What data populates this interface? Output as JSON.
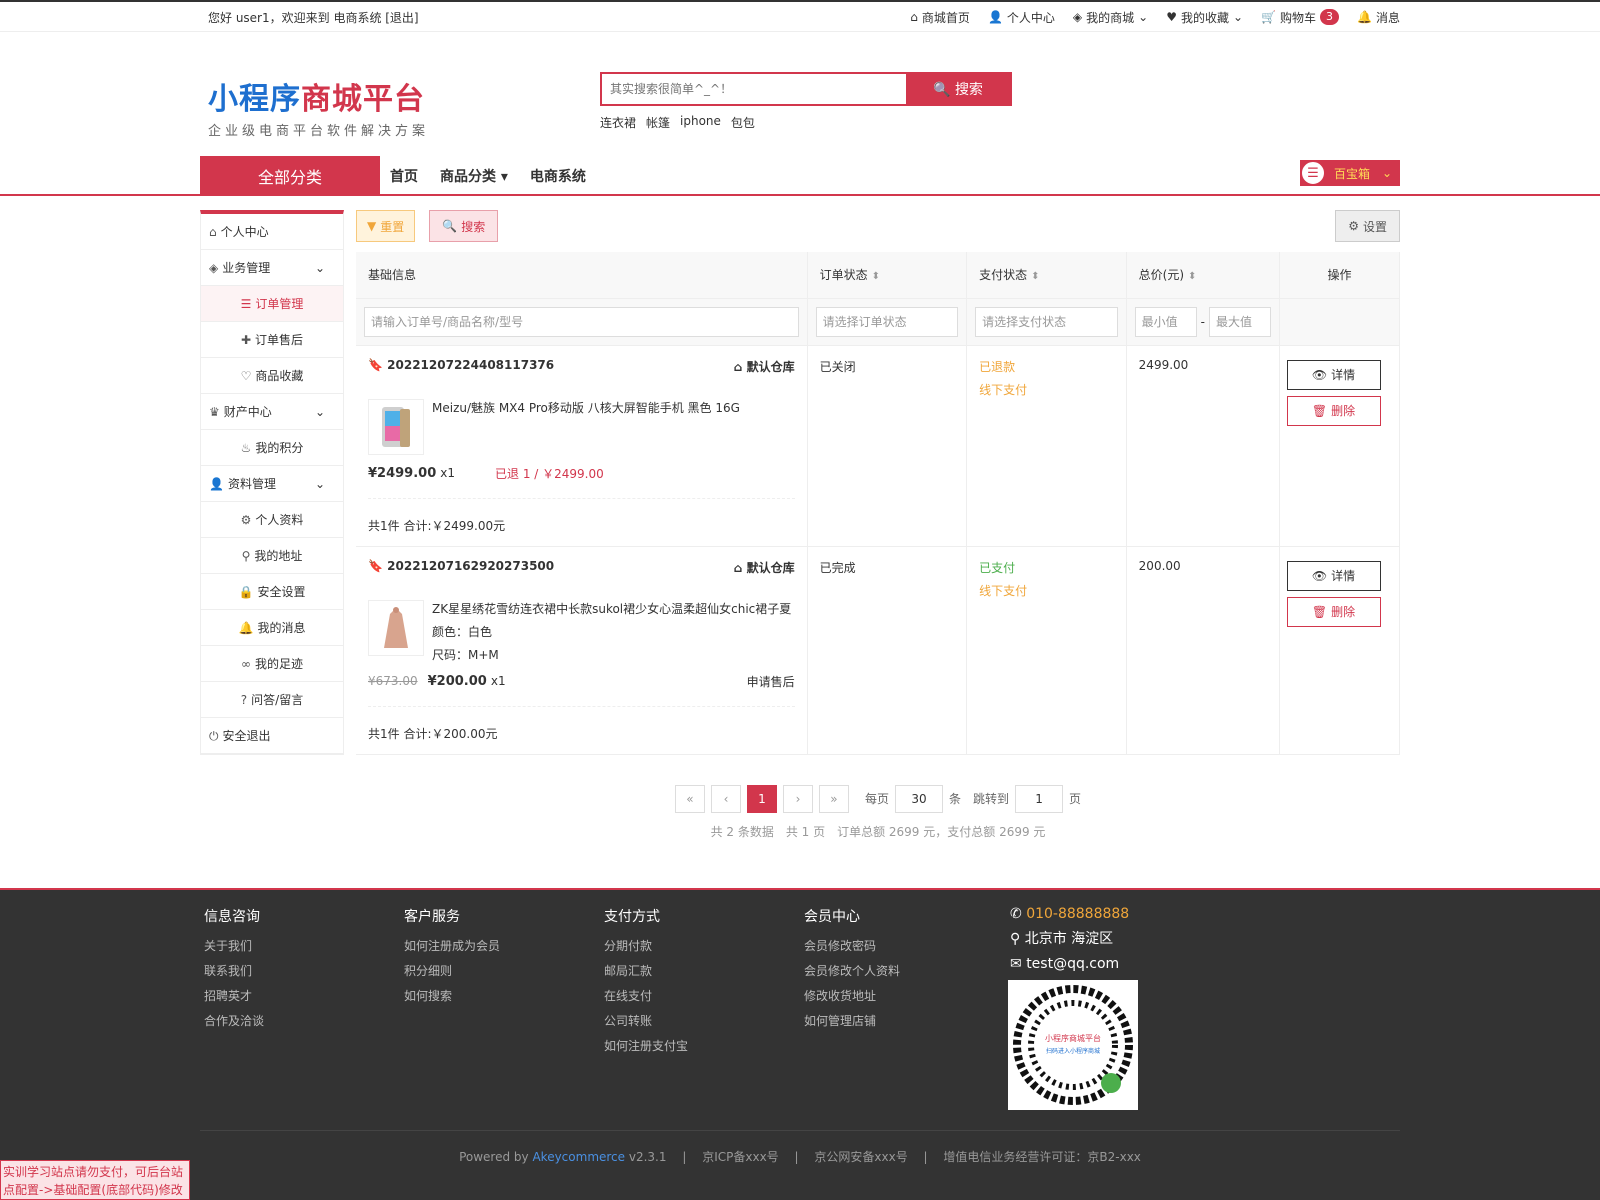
{
  "topbar": {
    "welcome": "您好 user1，欢迎来到 电商系统 [退出]",
    "links": [
      "商城首页",
      "个人中心",
      "我的商城",
      "我的收藏",
      "购物车",
      "消息"
    ],
    "cart_count": "3"
  },
  "header": {
    "logo_blue": "小程序",
    "logo_red": "商城平台",
    "logo_sub": "企业级电商平台软件解决方案",
    "search_placeholder": "其实搜索很简单^_^！",
    "search_button": "搜索",
    "hot": [
      "连衣裙",
      "帐篷",
      "iphone",
      "包包"
    ]
  },
  "nav": {
    "all": "全部分类",
    "links": [
      "首页",
      "商品分类",
      "电商系统"
    ],
    "bao": "百宝箱"
  },
  "sidebar": [
    {
      "label": "个人中心",
      "type": "top",
      "icon": "home-icon"
    },
    {
      "label": "业务管理",
      "type": "group",
      "icon": "cube-icon"
    },
    {
      "label": "订单管理",
      "type": "sub",
      "icon": "list-icon",
      "active": true
    },
    {
      "label": "订单售后",
      "type": "sub",
      "icon": "puzzle-icon"
    },
    {
      "label": "商品收藏",
      "type": "sub",
      "icon": "heart-icon"
    },
    {
      "label": "财产中心",
      "type": "group",
      "icon": "trophy-icon"
    },
    {
      "label": "我的积分",
      "type": "sub",
      "icon": "fire-icon"
    },
    {
      "label": "资料管理",
      "type": "group",
      "icon": "user-icon"
    },
    {
      "label": "个人资料",
      "type": "sub",
      "icon": "gear-icon"
    },
    {
      "label": "我的地址",
      "type": "sub",
      "icon": "pin-icon"
    },
    {
      "label": "安全设置",
      "type": "sub",
      "icon": "lock-icon"
    },
    {
      "label": "我的消息",
      "type": "sub",
      "icon": "bell-icon"
    },
    {
      "label": "我的足迹",
      "type": "sub",
      "icon": "footprint-icon"
    },
    {
      "label": "问答/留言",
      "type": "sub",
      "icon": "question-icon"
    },
    {
      "label": "安全退出",
      "type": "top",
      "icon": "power-icon"
    }
  ],
  "toolbar": {
    "reset": "重置",
    "search": "搜索",
    "settings": "设置"
  },
  "table": {
    "headers": [
      "基础信息",
      "订单状态",
      "支付状态",
      "总价(元)",
      "操作"
    ],
    "filters": {
      "keyword": "请输入订单号/商品名称/型号",
      "order_status": "请选择订单状态",
      "pay_status": "请选择支付状态",
      "min": "最小值",
      "max": "最大值",
      "dash": "-"
    },
    "orders": [
      {
        "no": "20221207224408117376",
        "warehouse": "默认仓库",
        "product": "Meizu/魅族 MX4 Pro移动版 八核大屏智能手机 黑色 16G",
        "spec": [],
        "old_price": "",
        "price": "¥2499.00",
        "qty": "x1",
        "refund": "已退 1 / ￥2499.00",
        "after_sale": "",
        "total_text": "共1件 合计:￥2499.00元",
        "order_status": "已关闭",
        "pay_status": "已退款",
        "pay_method": "线下支付",
        "amount": "2499.00"
      },
      {
        "no": "20221207162920273500",
        "warehouse": "默认仓库",
        "product": "ZK星星绣花雪纺连衣裙中长款sukol裙少女心温柔超仙女chic裙子夏",
        "spec": [
          "颜色：白色",
          "尺码：M+M"
        ],
        "old_price": "¥673.00",
        "price": "¥200.00",
        "qty": "x1",
        "refund": "",
        "after_sale": "申请售后",
        "total_text": "共1件 合计:￥200.00元",
        "order_status": "已完成",
        "pay_status": "已支付",
        "pay_method": "线下支付",
        "amount": "200.00"
      }
    ],
    "op_detail": "详情",
    "op_delete": "删除"
  },
  "pager": {
    "first": "«",
    "prev": "‹",
    "current": "1",
    "next": "›",
    "last": "»",
    "per_page_label": "每页",
    "per_page": "30",
    "unit": "条",
    "jump_label": "跳转到",
    "jump": "1",
    "page_unit": "页",
    "summary": "共 2 条数据　共 1 页　订单总额 2699 元，支付总额 2699 元"
  },
  "footer": {
    "cols": [
      {
        "title": "信息咨询",
        "items": [
          "关于我们",
          "联系我们",
          "招聘英才",
          "合作及洽谈"
        ]
      },
      {
        "title": "客户服务",
        "items": [
          "如何注册成为会员",
          "积分细则",
          "如何搜索"
        ]
      },
      {
        "title": "支付方式",
        "items": [
          "分期付款",
          "邮局汇款",
          "在线支付",
          "公司转账",
          "如何注册支付宝"
        ]
      },
      {
        "title": "会员中心",
        "items": [
          "会员修改密码",
          "会员修改个人资料",
          "修改收货地址",
          "如何管理店铺"
        ]
      }
    ],
    "tel": "010-88888888",
    "address": "北京市 海淀区",
    "email": "test@qq.com",
    "qr_text1": "小程序商城平台",
    "qr_text2": "扫码进入小程序商城",
    "powered": "Powered by",
    "brand": "Akeycommerce",
    "version": "v2.3.1",
    "icp": "京ICP备xxx号",
    "police": "京公网安备xxx号",
    "license": "增值电信业务经营许可证：京B2-xxx"
  },
  "note": "实训学习站点请勿支付，可后台站点配置->基础配置(底部代码)修改"
}
